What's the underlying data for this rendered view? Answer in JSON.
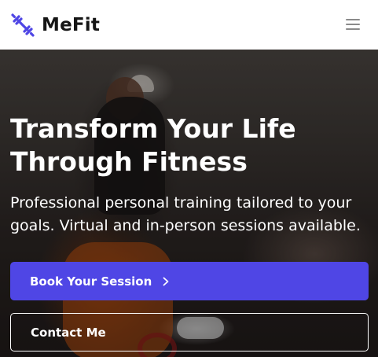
{
  "brand": {
    "name": "MeFit",
    "logo_icon": "dumbbell-icon",
    "accent_color": "#4f46e5"
  },
  "header": {
    "menu_icon": "hamburger-menu-icon"
  },
  "hero": {
    "title_line1": "Transform Your Life",
    "title_line2": "Through Fitness",
    "subtitle_line1": "Professional personal training tailored to your",
    "subtitle_line2": "goals. Virtual and in-person sessions available.",
    "primary_button": {
      "label": "Book Your Session",
      "icon": "chevron-right-icon"
    },
    "secondary_button": {
      "label": "Contact Me"
    }
  }
}
